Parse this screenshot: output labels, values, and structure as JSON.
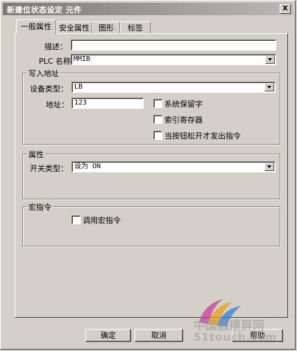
{
  "window": {
    "title": "新建位状态设定 元件",
    "close": "X"
  },
  "tabs": [
    "一般属性",
    "安全属性",
    "图形",
    "标签"
  ],
  "general": {
    "desc_label": "描述：",
    "desc_value": "",
    "plc_label": "PLC 名称",
    "plc_value": "MMIB"
  },
  "write_addr": {
    "title": "写入地址",
    "device_label": "设备类型：",
    "device_value": "LB",
    "addr_label": "地址：",
    "addr_value": "123",
    "opt_sys": "系统保留字",
    "opt_index": "索引寄存器",
    "opt_release": "当按钮松开才发出指令"
  },
  "attributes": {
    "title": "属性",
    "switch_label": "开关类型：",
    "switch_value": "设为 ON"
  },
  "macro": {
    "title": "宏指令",
    "call_label": "调用宏指令"
  },
  "buttons": {
    "ok": "确定",
    "cancel": "取消",
    "help": "帮助"
  },
  "watermark": {
    "site_cn": "中国触摸屏网",
    "site_en": "51touch.com"
  }
}
